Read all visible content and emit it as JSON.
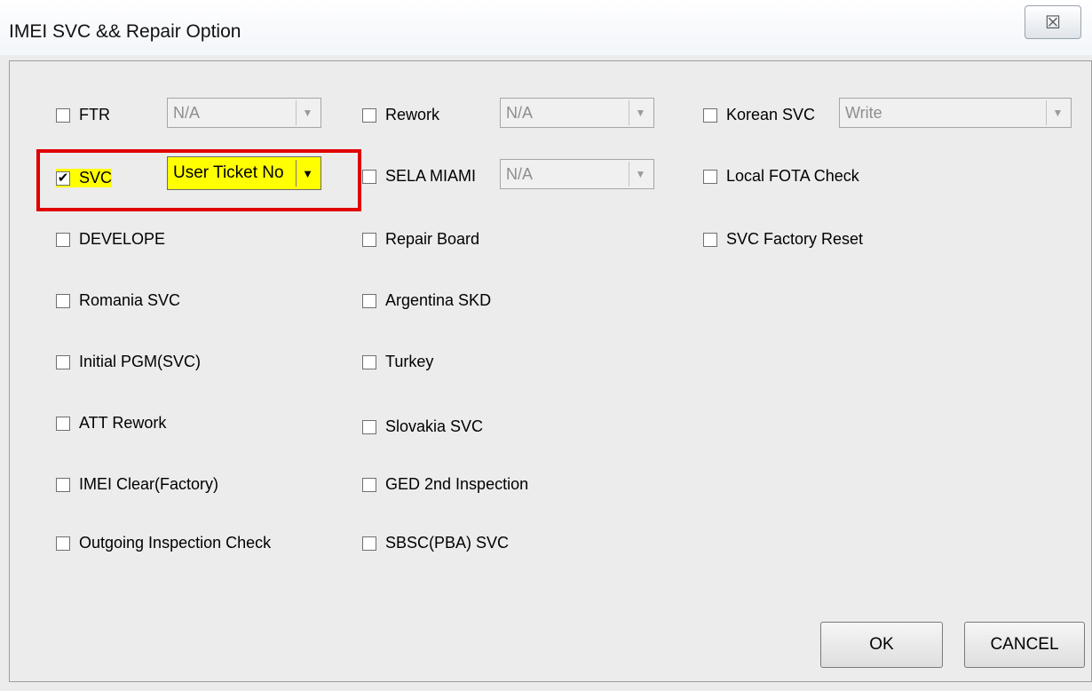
{
  "dialog": {
    "title": "IMEI SVC && Repair Option",
    "close_glyph": "☒",
    "close_icon": "close-icon"
  },
  "options": {
    "ftr": {
      "label": "FTR",
      "checked": false,
      "combo": "N/A"
    },
    "svc": {
      "label": "SVC",
      "checked": true,
      "combo": "User Ticket No"
    },
    "develope": {
      "label": "DEVELOPE",
      "checked": false
    },
    "romania_svc": {
      "label": "Romania SVC",
      "checked": false
    },
    "initial_pgm": {
      "label": "Initial PGM(SVC)",
      "checked": false
    },
    "att_rework": {
      "label": "ATT Rework",
      "checked": false
    },
    "imei_clear": {
      "label": "IMEI Clear(Factory)",
      "checked": false
    },
    "outgoing_inspection": {
      "label": "Outgoing Inspection Check",
      "checked": false
    },
    "rework": {
      "label": "Rework",
      "checked": false,
      "combo": "N/A"
    },
    "sela_miami": {
      "label": "SELA MIAMI",
      "checked": false,
      "combo": "N/A"
    },
    "repair_board": {
      "label": "Repair Board",
      "checked": false
    },
    "argentina_skd": {
      "label": "Argentina SKD",
      "checked": false
    },
    "turkey": {
      "label": "Turkey",
      "checked": false
    },
    "slovakia_svc": {
      "label": "Slovakia SVC",
      "checked": false
    },
    "ged_2nd": {
      "label": "GED 2nd Inspection",
      "checked": false
    },
    "sbsc_pba": {
      "label": "SBSC(PBA) SVC",
      "checked": false
    },
    "korean_svc": {
      "label": "Korean SVC",
      "checked": false,
      "combo": "Write"
    },
    "local_fota": {
      "label": "Local FOTA Check",
      "checked": false
    },
    "svc_factory_reset": {
      "label": "SVC Factory Reset",
      "checked": false
    }
  },
  "glyphs": {
    "check": "✔",
    "dropdown": "▼"
  },
  "buttons": {
    "ok": "OK",
    "cancel": "CANCEL"
  },
  "colors": {
    "highlight": "#ffff00",
    "annotation_box": "#e00000"
  }
}
